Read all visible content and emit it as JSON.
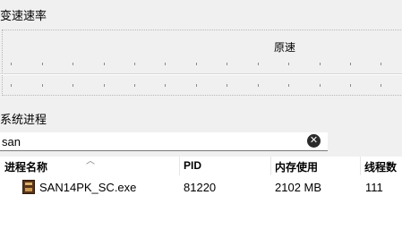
{
  "speed": {
    "section_title": "变速速率",
    "current_label": "原速"
  },
  "process": {
    "section_title": "系统进程",
    "search_value": "san",
    "clear_icon": "close-circle-icon",
    "columns": [
      "进程名称",
      "PID",
      "内存使用",
      "线程数"
    ],
    "rows": [
      {
        "name": "SAN14PK_SC.exe",
        "pid": "81220",
        "memory": "2102 MB",
        "threads": "111",
        "icon": "game-app-icon"
      }
    ]
  }
}
